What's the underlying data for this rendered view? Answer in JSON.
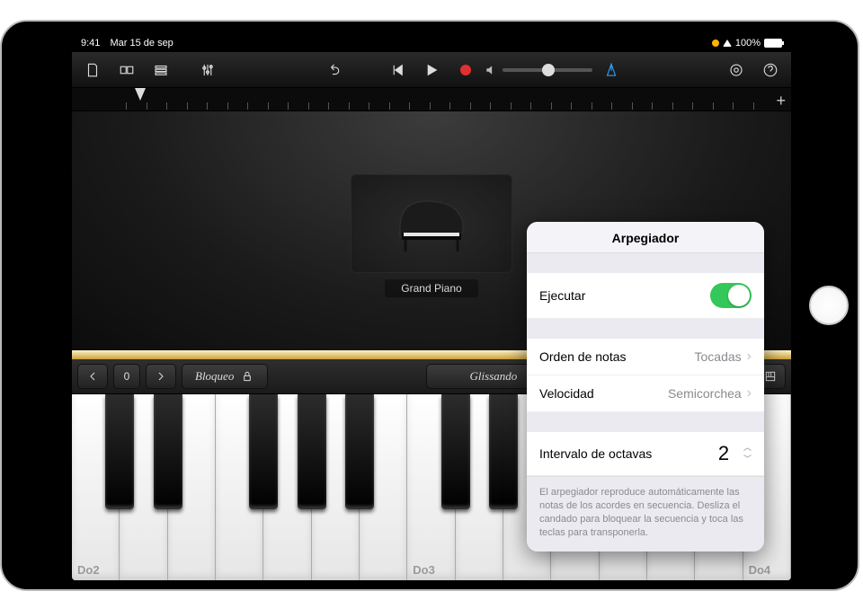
{
  "status": {
    "time": "9:41",
    "date": "Mar 15 de sep",
    "battery_pct": "100%"
  },
  "instrument": {
    "name": "Grand Piano"
  },
  "keybar": {
    "octave_value": "0",
    "lock_label": "Bloqueo",
    "mode_label": "Glissando"
  },
  "key_labels": {
    "c2": "Do2",
    "c3": "Do3",
    "c4": "Do4"
  },
  "popover": {
    "title": "Arpegiador",
    "run_label": "Ejecutar",
    "run_on": true,
    "order_label": "Orden de notas",
    "order_value": "Tocadas",
    "speed_label": "Velocidad",
    "speed_value": "Semicorchea",
    "range_label": "Intervalo de octavas",
    "range_value": "2",
    "footer": "El arpegiador reproduce automáticamente las notas de los acordes en secuencia. Desliza el candado para bloquear la secuencia y toca las teclas para transponerla."
  }
}
